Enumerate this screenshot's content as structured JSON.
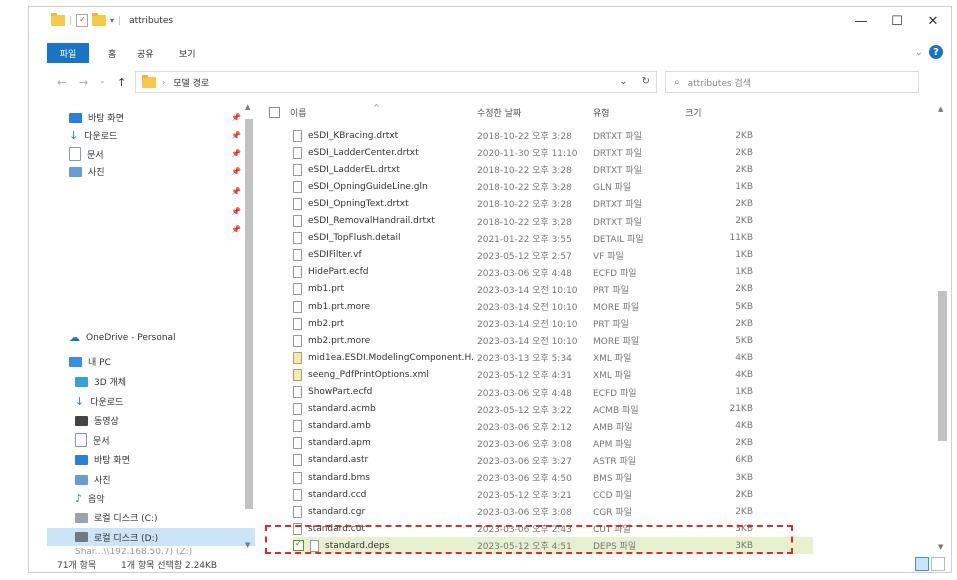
{
  "window": {
    "title": "attributes"
  },
  "ribbon": {
    "tabs": [
      "파일",
      "홈",
      "공유",
      "보기"
    ]
  },
  "address": {
    "path": "모델 경로"
  },
  "search": {
    "placeholder": "attributes 검색"
  },
  "nav": {
    "quick": [
      "바탕 화면",
      "다운로드",
      "문서",
      "사진"
    ],
    "onedrive": "OneDrive - Personal",
    "pc": "내 PC",
    "pc_items": [
      "3D 개체",
      "다운로드",
      "동영상",
      "문서",
      "바탕 화면",
      "사진",
      "음악",
      "로컬 디스크 (C:)",
      "로컬 디스크 (D:)"
    ],
    "truncated": "Shar...\\\\192.168.50.7) (Z:)"
  },
  "columns": {
    "name": "이름",
    "date": "수정한 날짜",
    "type": "유형",
    "size": "크기"
  },
  "files": [
    {
      "name": "eSDI_KBracing.drtxt",
      "date": "2018-10-22 오후 3:28",
      "type": "DRTXT 파일",
      "size": "2KB",
      "icon": "file"
    },
    {
      "name": "eSDI_LadderCenter.drtxt",
      "date": "2020-11-30 오후 11:10",
      "type": "DRTXT 파일",
      "size": "2KB",
      "icon": "file"
    },
    {
      "name": "eSDI_LadderEL.drtxt",
      "date": "2018-10-22 오후 3:28",
      "type": "DRTXT 파일",
      "size": "2KB",
      "icon": "file"
    },
    {
      "name": "eSDI_OpningGuideLine.gln",
      "date": "2018-10-22 오후 3:28",
      "type": "GLN 파일",
      "size": "1KB",
      "icon": "file"
    },
    {
      "name": "eSDI_OpningText.drtxt",
      "date": "2018-10-22 오후 3:28",
      "type": "DRTXT 파일",
      "size": "2KB",
      "icon": "file"
    },
    {
      "name": "eSDI_RemovalHandrail.drtxt",
      "date": "2018-10-22 오후 3:28",
      "type": "DRTXT 파일",
      "size": "2KB",
      "icon": "file"
    },
    {
      "name": "eSDI_TopFlush.detail",
      "date": "2021-01-22 오후 3:55",
      "type": "DETAIL 파일",
      "size": "11KB",
      "icon": "file"
    },
    {
      "name": "eSDIFilter.vf",
      "date": "2023-05-12 오후 2:57",
      "type": "VF 파일",
      "size": "1KB",
      "icon": "file"
    },
    {
      "name": "HidePart.ecfd",
      "date": "2023-03-06 오후 4:48",
      "type": "ECFD 파일",
      "size": "1KB",
      "icon": "file"
    },
    {
      "name": "mb1.prt",
      "date": "2023-03-14 오전 10:10",
      "type": "PRT 파일",
      "size": "2KB",
      "icon": "file"
    },
    {
      "name": "mb1.prt.more",
      "date": "2023-03-14 오전 10:10",
      "type": "MORE 파일",
      "size": "5KB",
      "icon": "file"
    },
    {
      "name": "mb2.prt",
      "date": "2023-03-14 오전 10:10",
      "type": "PRT 파일",
      "size": "2KB",
      "icon": "file"
    },
    {
      "name": "mb2.prt.more",
      "date": "2023-03-14 오전 10:10",
      "type": "MORE 파일",
      "size": "5KB",
      "icon": "file"
    },
    {
      "name": "mid1ea.ESDI.ModelingComponent.H...",
      "date": "2023-03-13 오후 5:34",
      "type": "XML 파일",
      "size": "4KB",
      "icon": "xml"
    },
    {
      "name": "seeng_PdfPrintOptions.xml",
      "date": "2023-05-12 오후 4:31",
      "type": "XML 파일",
      "size": "4KB",
      "icon": "xml"
    },
    {
      "name": "ShowPart.ecfd",
      "date": "2023-03-06 오후 4:48",
      "type": "ECFD 파일",
      "size": "1KB",
      "icon": "file"
    },
    {
      "name": "standard.acmb",
      "date": "2023-05-12 오후 3:22",
      "type": "ACMB 파일",
      "size": "21KB",
      "icon": "file"
    },
    {
      "name": "standard.amb",
      "date": "2023-03-06 오후 2:12",
      "type": "AMB 파일",
      "size": "4KB",
      "icon": "file"
    },
    {
      "name": "standard.apm",
      "date": "2023-03-06 오후 3:08",
      "type": "APM 파일",
      "size": "2KB",
      "icon": "file"
    },
    {
      "name": "standard.astr",
      "date": "2023-03-06 오후 3:27",
      "type": "ASTR 파일",
      "size": "6KB",
      "icon": "file"
    },
    {
      "name": "standard.bms",
      "date": "2023-03-06 오후 4:50",
      "type": "BMS 파일",
      "size": "3KB",
      "icon": "file"
    },
    {
      "name": "standard.ccd",
      "date": "2023-05-12 오후 3:21",
      "type": "CCD 파일",
      "size": "2KB",
      "icon": "file"
    },
    {
      "name": "standard.cgr",
      "date": "2023-03-06 오후 3:08",
      "type": "CGR 파일",
      "size": "2KB",
      "icon": "file"
    },
    {
      "name": "standard.cut",
      "date": "2023-03-06 오후 2:43",
      "type": "CUT 파일",
      "size": "3KB",
      "icon": "file"
    }
  ],
  "selected_file": {
    "name": "standard.deps",
    "date": "2023-05-12 오후 4:51",
    "type": "DEPS 파일",
    "size": "3KB"
  },
  "status": {
    "count": "71개 항목",
    "selection": "1개 항목 선택함 2.24KB"
  },
  "colors": {
    "accent": "#1a73c5",
    "highlight": "#d32f2f",
    "selected_row": "#e6f2cf"
  }
}
